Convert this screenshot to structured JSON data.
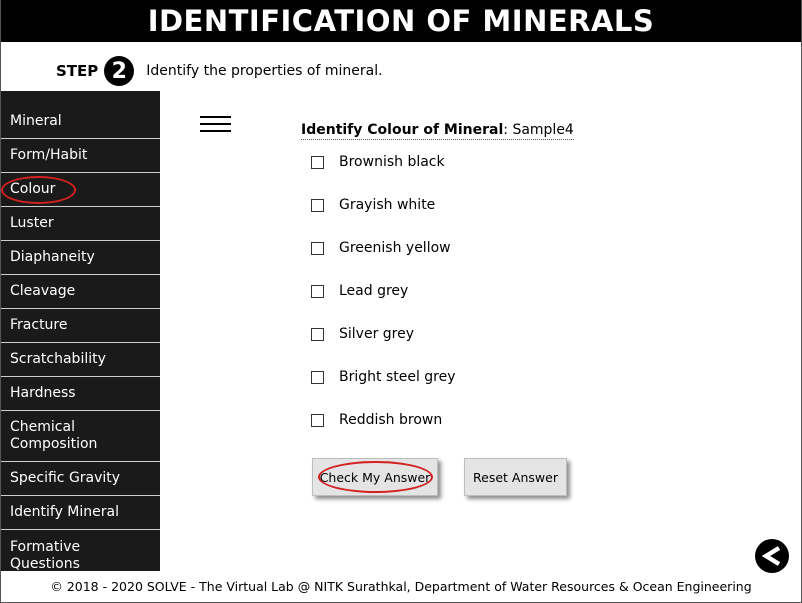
{
  "header": {
    "title": "IDENTIFICATION OF MINERALS"
  },
  "step": {
    "label": "STEP",
    "number": "2",
    "instruction": "Identify the properties of mineral."
  },
  "sidebar": {
    "items": [
      {
        "label": "Mineral"
      },
      {
        "label": "Form/Habit"
      },
      {
        "label": "Colour"
      },
      {
        "label": "Luster"
      },
      {
        "label": "Diaphaneity"
      },
      {
        "label": "Cleavage"
      },
      {
        "label": "Fracture"
      },
      {
        "label": "Scratchability"
      },
      {
        "label": "Hardness"
      },
      {
        "label": "Chemical Composition"
      },
      {
        "label": "Specific Gravity"
      },
      {
        "label": "Identify Mineral"
      },
      {
        "label": "Formative Questions"
      }
    ],
    "highlighted": "Colour"
  },
  "question": {
    "prompt": "Identify Colour of Mineral",
    "separator": ":",
    "sample": "Sample4"
  },
  "options": [
    {
      "label": "Brownish black",
      "checked": false
    },
    {
      "label": "Grayish white",
      "checked": false
    },
    {
      "label": "Greenish yellow",
      "checked": false
    },
    {
      "label": "Lead grey",
      "checked": false
    },
    {
      "label": "Silver grey",
      "checked": false
    },
    {
      "label": "Bright steel grey",
      "checked": false
    },
    {
      "label": "Reddish brown",
      "checked": false
    }
  ],
  "buttons": {
    "check_label": "Check My Answer",
    "reset_label": "Reset Answer"
  },
  "footer": {
    "text": "© 2018 - 2020 SOLVE - The Virtual Lab @ NITK Surathkal, Department of Water Resources & Ocean Engineering"
  },
  "colors": {
    "highlight_ring": "#d32020",
    "sidebar_bg": "#1a1a1a",
    "header_bg": "#000000",
    "button_bg": "#e4e4e4"
  },
  "icons": {
    "menu": "hamburger-menu-icon",
    "back": "back-arrow-icon"
  }
}
